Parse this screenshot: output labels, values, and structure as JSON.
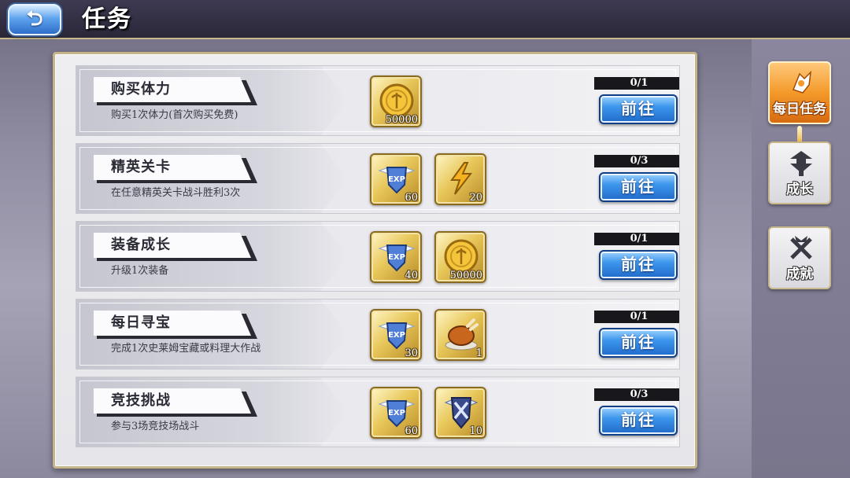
{
  "header": {
    "back_icon": "back-arrow-icon",
    "back_label": "⮌",
    "title": "任务"
  },
  "tasks": [
    {
      "name": "购买体力",
      "desc": "购买1次体力(首次购买免费)",
      "progress": "0/1",
      "button": "前往",
      "rewards": [
        {
          "icon": "gold-coin-icon",
          "count": "50000"
        }
      ]
    },
    {
      "name": "精英关卡",
      "desc": "在任意精英关卡战斗胜利3次",
      "progress": "0/3",
      "button": "前往",
      "rewards": [
        {
          "icon": "exp-shield-icon",
          "count": "60"
        },
        {
          "icon": "lightning-stamina-icon",
          "count": "20"
        }
      ]
    },
    {
      "name": "装备成长",
      "desc": "升级1次装备",
      "progress": "0/1",
      "button": "前往",
      "rewards": [
        {
          "icon": "exp-shield-icon",
          "count": "40"
        },
        {
          "icon": "gold-coin-icon",
          "count": "50000"
        }
      ]
    },
    {
      "name": "每日寻宝",
      "desc": "完成1次史莱姆宝藏或料理大作战",
      "progress": "0/1",
      "button": "前往",
      "rewards": [
        {
          "icon": "exp-shield-icon",
          "count": "30"
        },
        {
          "icon": "roast-chicken-icon",
          "count": "1"
        }
      ]
    },
    {
      "name": "竞技挑战",
      "desc": "参与3场竞技场战斗",
      "progress": "0/3",
      "button": "前往",
      "rewards": [
        {
          "icon": "exp-shield-icon",
          "count": "60"
        },
        {
          "icon": "arena-crest-icon",
          "count": "10"
        }
      ]
    }
  ],
  "sidebar": {
    "tabs": [
      {
        "label": "每日任务",
        "icon": "daily-task-icon",
        "active": true
      },
      {
        "label": "成长",
        "icon": "growth-icon",
        "active": false
      },
      {
        "label": "成就",
        "icon": "achievement-icon",
        "active": false
      }
    ]
  },
  "colors": {
    "accent_orange": "#f39a2a",
    "button_blue": "#3e97ec",
    "frame_gold": "#c6b58a"
  }
}
